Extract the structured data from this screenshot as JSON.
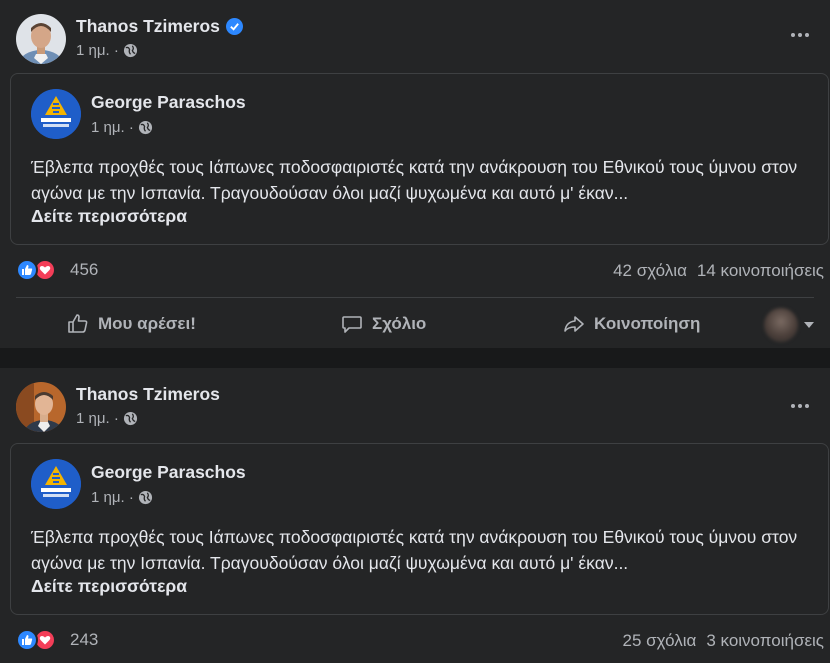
{
  "posts": [
    {
      "author": "Thanos Tzimeros",
      "verified": true,
      "time": "1 ημ. ·",
      "shared": {
        "author": "George Paraschos",
        "time": "1 ημ. ·",
        "text": "Έβλεπα προχθές τους Ιάπωνες ποδοσφαιριστές κατά την ανάκρουση του Εθνικού τους ύμνου στον αγώνα με την Ισπανία. Τραγουδούσαν όλοι μαζί ψυχωμένα και αυτό μ' έκαν...",
        "see_more": "Δείτε περισσότερα"
      },
      "reactions": "456",
      "comments": "42 σχόλια",
      "shares": "14 κοινοποιήσεις",
      "actions": {
        "like": "Μου αρέσει!",
        "comment": "Σχόλιο",
        "share": "Κοινοποίηση"
      }
    },
    {
      "author": "Thanos Tzimeros",
      "verified": false,
      "time": "1 ημ. ·",
      "shared": {
        "author": "George Paraschos",
        "time": "1 ημ. ·",
        "text": "Έβλεπα προχθές τους Ιάπωνες ποδοσφαιριστές κατά την ανάκρουση του Εθνικού τους ύμνου στον αγώνα με την Ισπανία. Τραγουδούσαν όλοι μαζί ψυχωμένα και αυτό μ' έκαν...",
        "see_more": "Δείτε περισσότερα"
      },
      "reactions": "243",
      "comments": "25 σχόλια",
      "shares": "3 κοινοποιήσεις"
    }
  ],
  "colors": {
    "background": "#18191a",
    "card": "#242526",
    "border": "#3e4042",
    "text": "#e4e6eb",
    "muted": "#b0b3b8",
    "accent": "#2d88ff",
    "love": "#f33e58"
  },
  "icons": [
    "verified-badge-icon",
    "globe-icon",
    "more-options-icon",
    "like-reaction-icon",
    "love-reaction-icon",
    "thumbs-up-icon",
    "comment-icon",
    "share-icon",
    "caret-down-icon"
  ]
}
